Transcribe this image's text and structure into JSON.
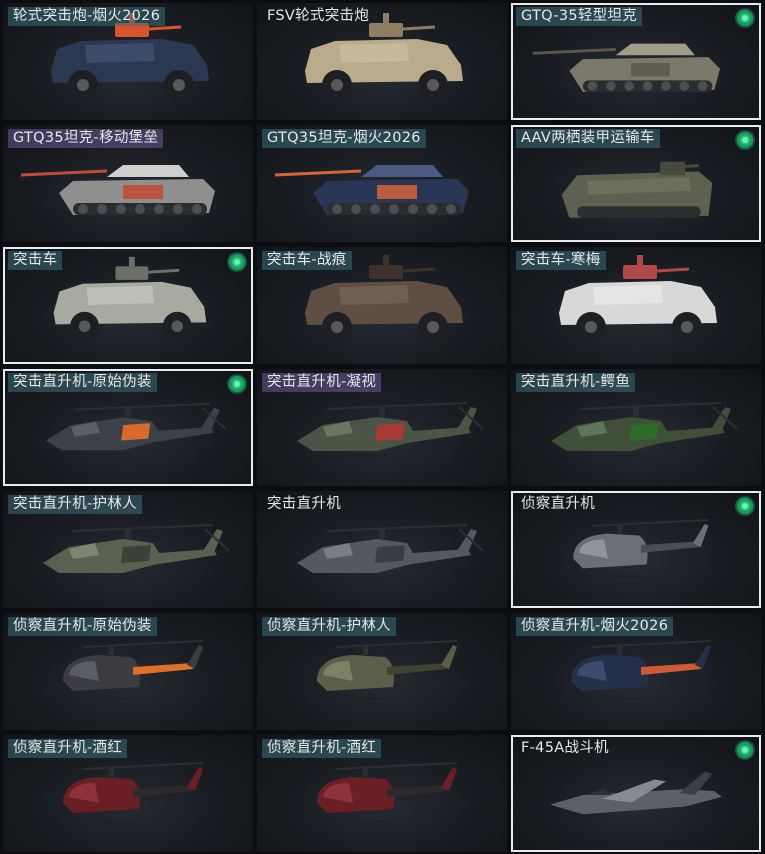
{
  "items": [
    {
      "name": "轮式突击炮-烟火2026",
      "type": "apc",
      "palette": {
        "body": "#2c3852",
        "accent": "#d9532f",
        "hi": "#4b5c80"
      },
      "selected": false,
      "owned": false,
      "tag": "teal"
    },
    {
      "name": "FSV轮式突击炮",
      "type": "apc",
      "palette": {
        "body": "#b9ab8c",
        "accent": "#8d7e62",
        "hi": "#d4c7a8"
      },
      "selected": false,
      "owned": false,
      "tag": "none"
    },
    {
      "name": "GTQ-35轻型坦克",
      "type": "tank",
      "palette": {
        "body": "#7c786b",
        "accent": "#5b574d",
        "hi": "#a29c8b"
      },
      "selected": true,
      "owned": true,
      "tag": "teal"
    },
    {
      "name": "GTQ35坦克-移动堡垒",
      "type": "tank",
      "palette": {
        "body": "#8f8f8f",
        "accent": "#c44a3a",
        "hi": "#cfcfcf"
      },
      "selected": false,
      "owned": false,
      "tag": "purple"
    },
    {
      "name": "GTQ35坦克-烟火2026",
      "type": "tank",
      "palette": {
        "body": "#2a3656",
        "accent": "#d7643b",
        "hi": "#4a5a82"
      },
      "selected": false,
      "owned": false,
      "tag": "teal"
    },
    {
      "name": "AAV两栖装甲运输车",
      "type": "aav",
      "palette": {
        "body": "#5c6150",
        "accent": "#474b3e",
        "hi": "#7a806a"
      },
      "selected": true,
      "owned": true,
      "tag": "teal"
    },
    {
      "name": "突击车",
      "type": "truck",
      "palette": {
        "body": "#a7aa9f",
        "accent": "#6d7068",
        "hi": "#cfd2c8"
      },
      "selected": true,
      "owned": true,
      "tag": "teal"
    },
    {
      "name": "突击车-战痕",
      "type": "truck",
      "palette": {
        "body": "#5e4e43",
        "accent": "#3c322b",
        "hi": "#7f6b5d"
      },
      "selected": false,
      "owned": false,
      "tag": "teal"
    },
    {
      "name": "突击车-寒梅",
      "type": "truck",
      "palette": {
        "body": "#d8d8d8",
        "accent": "#b04848",
        "hi": "#f0f0f0"
      },
      "selected": false,
      "owned": false,
      "tag": "teal"
    },
    {
      "name": "突击直升机-原始伪装",
      "type": "attack-heli",
      "palette": {
        "body": "#3d4048",
        "accent": "#d86b2c",
        "hi": "#5a5e68"
      },
      "selected": true,
      "owned": true,
      "tag": "teal"
    },
    {
      "name": "突击直升机-凝视",
      "type": "attack-heli",
      "palette": {
        "body": "#4b5545",
        "accent": "#a83a35",
        "hi": "#6a7562"
      },
      "selected": false,
      "owned": false,
      "tag": "purple"
    },
    {
      "name": "突击直升机-鳄鱼",
      "type": "attack-heli",
      "palette": {
        "body": "#3f4f39",
        "accent": "#2f6b2a",
        "hi": "#5f7557"
      },
      "selected": false,
      "owned": false,
      "tag": "teal"
    },
    {
      "name": "突击直升机-护林人",
      "type": "attack-heli",
      "palette": {
        "body": "#5b6150",
        "accent": "#3d4237",
        "hi": "#7e8570"
      },
      "selected": false,
      "owned": false,
      "tag": "teal"
    },
    {
      "name": "突击直升机",
      "type": "attack-heli",
      "palette": {
        "body": "#55585e",
        "accent": "#3a3d42",
        "hi": "#7a7e85"
      },
      "selected": false,
      "owned": false,
      "tag": "none"
    },
    {
      "name": "侦察直升机",
      "type": "scout-heli",
      "palette": {
        "body": "#6b6e74",
        "accent": "#4a4d52",
        "hi": "#90949b"
      },
      "selected": true,
      "owned": true,
      "tag": "none"
    },
    {
      "name": "侦察直升机-原始伪装",
      "type": "scout-heli",
      "palette": {
        "body": "#3b3d42",
        "accent": "#e06f2a",
        "hi": "#5a5d63"
      },
      "selected": false,
      "owned": false,
      "tag": "teal"
    },
    {
      "name": "侦察直升机-护林人",
      "type": "scout-heli",
      "palette": {
        "body": "#5b5f49",
        "accent": "#3f432f",
        "hi": "#7d8267"
      },
      "selected": false,
      "owned": false,
      "tag": "teal"
    },
    {
      "name": "侦察直升机-烟火2026",
      "type": "scout-heli",
      "palette": {
        "body": "#24304a",
        "accent": "#cf5a34",
        "hi": "#3d4c6e"
      },
      "selected": false,
      "owned": false,
      "tag": "teal"
    },
    {
      "name": "侦察直升机-酒红",
      "type": "scout-heli",
      "palette": {
        "body": "#6a1f24",
        "accent": "#2c2a2b",
        "hi": "#8c3339"
      },
      "selected": false,
      "owned": false,
      "tag": "teal"
    },
    {
      "name": "侦察直升机-酒红",
      "type": "scout-heli",
      "palette": {
        "body": "#6a1f24",
        "accent": "#2c2a2b",
        "hi": "#8c3339"
      },
      "selected": false,
      "owned": false,
      "tag": "teal"
    },
    {
      "name": "F-45A战斗机",
      "type": "jet",
      "palette": {
        "body": "#5d6167",
        "accent": "#3c3f44",
        "hi": "#868a91"
      },
      "selected": true,
      "owned": true,
      "tag": "none"
    }
  ]
}
